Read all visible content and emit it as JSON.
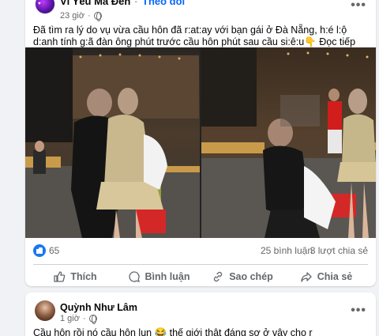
{
  "post1": {
    "page_name": "Vì Yêu Mà Đến",
    "follow_label": "Theo dõi",
    "separator": "·",
    "time": "23 giờ",
    "text": "Đã tìm ra lý do vụ vừa cầu hôn đã r:at:ay với bạn gái ở Đà Nẵng, h:é l:ộ d:anh tính g:ã đàn ông phút trước cầu hôn phút sau cầu si:ê:u👇 Đọc tiếp dưới bình luận👇",
    "reaction_count": "65",
    "comments": "25 bình luận",
    "shares": "3 lượt chia sẻ",
    "actions": {
      "like": "Thích",
      "comment": "Bình luận",
      "copy": "Sao chép",
      "share": "Chia sẻ"
    },
    "menu": "•••"
  },
  "post2": {
    "author": "Quỳnh Như Lâm",
    "time": "1 giờ",
    "separator": "·",
    "text": "Cầu hôn rồi nó cầu hôn lun 😂 thế giới thật đáng sợ ở vây cho r",
    "menu": "•••"
  },
  "colors": {
    "accent": "#0866ff",
    "like": "#1877f2",
    "secondary_text": "#65676b"
  }
}
